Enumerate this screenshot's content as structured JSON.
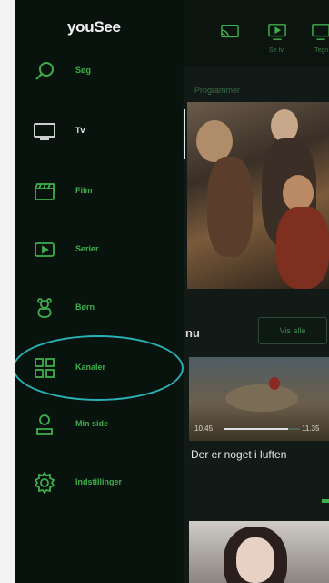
{
  "app": {
    "logo": "youSee"
  },
  "colors": {
    "accent": "#3fae4a",
    "background": "#0d1713",
    "highlight": "#2ab0b4"
  },
  "sidebar": {
    "items": [
      {
        "label": "Søg",
        "icon": "search-icon"
      },
      {
        "label": "Tv",
        "icon": "tv-icon"
      },
      {
        "label": "Film",
        "icon": "clapperboard-icon"
      },
      {
        "label": "Serier",
        "icon": "series-icon"
      },
      {
        "label": "Børn",
        "icon": "teddy-bear-icon"
      },
      {
        "label": "Kanaler",
        "icon": "grid-icon"
      },
      {
        "label": "Min side",
        "icon": "user-icon"
      },
      {
        "label": "Indstillinger",
        "icon": "gear-icon"
      }
    ]
  },
  "topbar": {
    "items": [
      {
        "label": "",
        "icon": "cast-icon"
      },
      {
        "label": "Se tv",
        "icon": "tv-play-icon"
      },
      {
        "label": "Tegn",
        "icon": "tv-partial-icon"
      }
    ]
  },
  "main": {
    "section_title": "Programmer",
    "now_title": "nu",
    "see_all_label": "Vis alle",
    "now_card": {
      "start_time": "10.45",
      "end_time": "11.35",
      "progress": 0.85,
      "title": "Der er noget i luften"
    }
  }
}
